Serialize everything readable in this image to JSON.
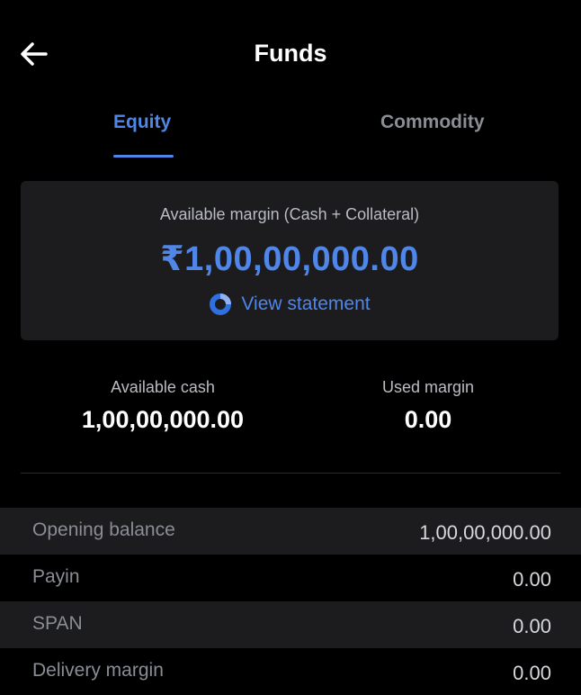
{
  "header": {
    "title": "Funds",
    "back_icon": "arrow-left-icon"
  },
  "tabs": [
    {
      "label": "Equity",
      "active": true
    },
    {
      "label": "Commodity",
      "active": false
    }
  ],
  "summary": {
    "label": "Available margin (Cash + Collateral)",
    "amount": "₹1,00,00,000.00",
    "view_statement": "View statement",
    "view_statement_icon": "statement-ring-icon"
  },
  "stats": {
    "available_cash_label": "Available cash",
    "available_cash_value": "1,00,00,000.00",
    "used_margin_label": "Used margin",
    "used_margin_value": "0.00"
  },
  "rows": [
    {
      "label": "Opening balance",
      "value": "1,00,00,000.00"
    },
    {
      "label": "Payin",
      "value": "0.00"
    },
    {
      "label": "SPAN",
      "value": "0.00"
    },
    {
      "label": "Delivery margin",
      "value": "0.00"
    }
  ],
  "colors": {
    "accent": "#4f86e8",
    "background": "#000000",
    "card": "#1c1c1f"
  }
}
